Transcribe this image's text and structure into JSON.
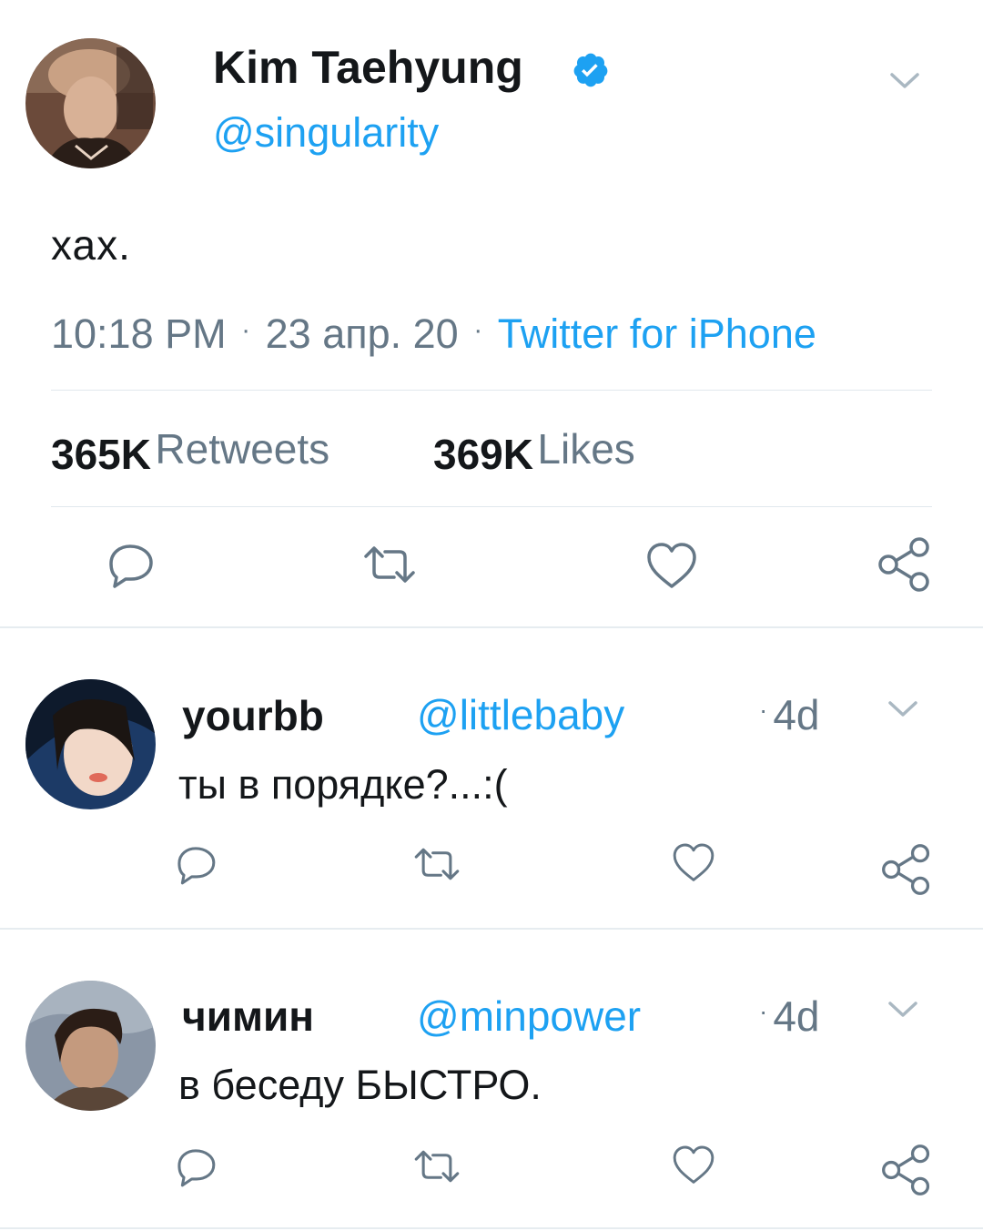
{
  "main_tweet": {
    "author_name": "Kim Taehyung",
    "handle": "@singularity",
    "verified": true,
    "text": "хах.",
    "time": "10:18 PM",
    "sep1": "·",
    "date": "23 апр. 20",
    "sep2": "·",
    "source": "Twitter for iPhone",
    "retweets_count": "365K",
    "retweets_label": "Retweets",
    "likes_count": "369K",
    "likes_label": "Likes"
  },
  "replies": [
    {
      "author_name": "yourbb",
      "handle": "@littlebaby",
      "sep": "·",
      "age": "4d",
      "text": "ты в порядке?...:("
    },
    {
      "author_name": "чимин",
      "handle": "@minpower",
      "sep": "·",
      "age": "4d",
      "text": "в беседу БЫСТРО."
    }
  ],
  "icons": {
    "reply": "reply-icon",
    "retweet": "retweet-icon",
    "like": "heart-icon",
    "share": "share-icon",
    "menu": "chevron-down-icon",
    "verified": "verified-badge-icon"
  },
  "colors": {
    "link": "#1da1f2",
    "muted": "#657786",
    "icon": "#657786",
    "divider": "#e1e8ed",
    "text": "#14171a"
  }
}
